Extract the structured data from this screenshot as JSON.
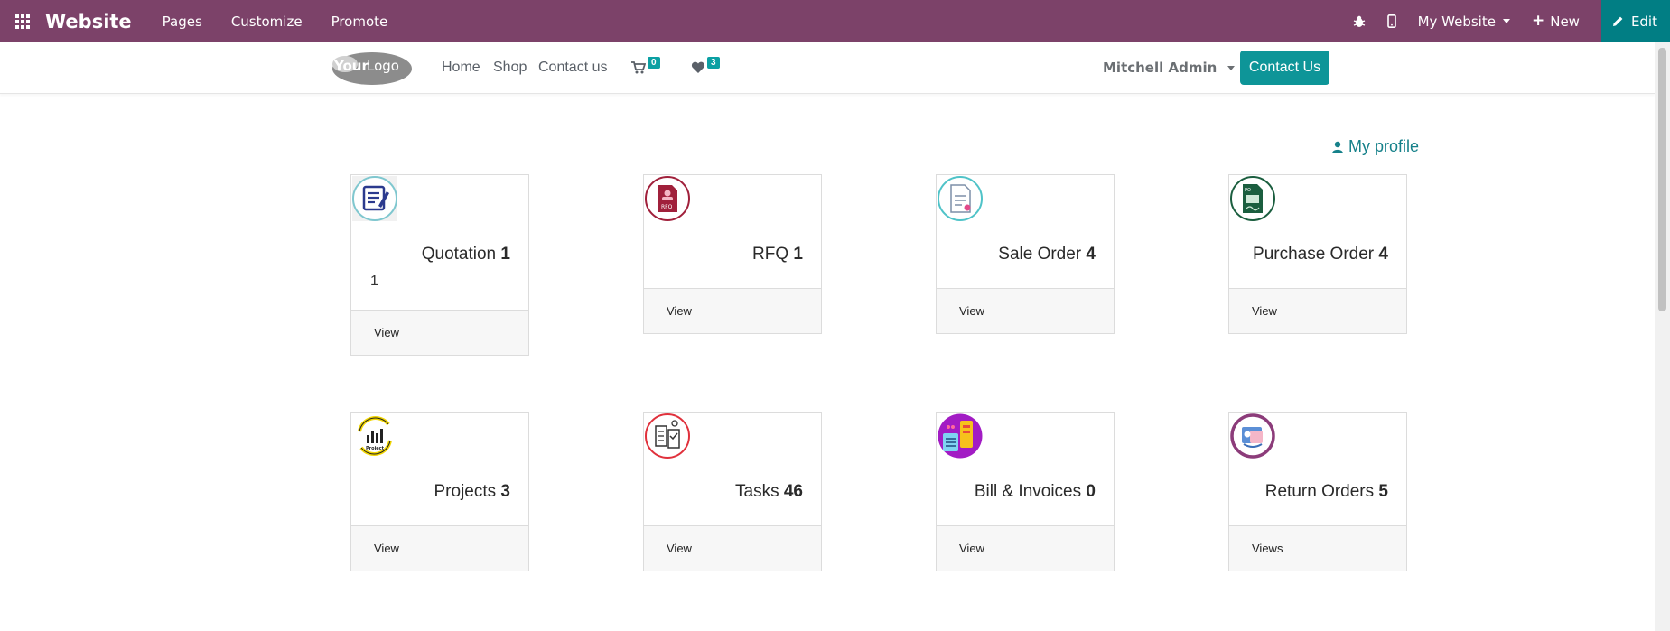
{
  "topbar": {
    "brand": "Website",
    "menus": [
      "Pages",
      "Customize",
      "Promote"
    ],
    "my_website": "My Website",
    "new": "New",
    "edit": "Edit",
    "bg": "#7c4269",
    "edit_bg": "#017e84"
  },
  "header": {
    "logo_text_bold": "Your",
    "logo_text": "Logo",
    "nav": [
      "Home",
      "Shop",
      "Contact us"
    ],
    "cart_count": "0",
    "wishlist_count": "3",
    "user": "Mitchell Admin",
    "contact_button": "Contact Us"
  },
  "profile_link": "My profile",
  "cards": [
    {
      "title": "Quotation",
      "count": "1",
      "subcount": "1",
      "action": "View",
      "icon": "quotation-icon"
    },
    {
      "title": "RFQ",
      "count": "1",
      "action": "View",
      "icon": "rfq-icon"
    },
    {
      "title": "Sale Order",
      "count": "4",
      "action": "View",
      "icon": "sale-order-icon"
    },
    {
      "title": "Purchase Order",
      "count": "4",
      "action": "View",
      "icon": "purchase-order-icon"
    },
    {
      "title": "Projects",
      "count": "3",
      "action": "View",
      "icon": "projects-icon"
    },
    {
      "title": "Tasks",
      "count": "46",
      "action": "View",
      "icon": "tasks-icon"
    },
    {
      "title": "Bill & Invoices",
      "count": "0",
      "action": "View",
      "icon": "bill-invoices-icon"
    },
    {
      "title": "Return Orders",
      "count": "5",
      "action": "Views",
      "icon": "return-orders-icon"
    }
  ]
}
